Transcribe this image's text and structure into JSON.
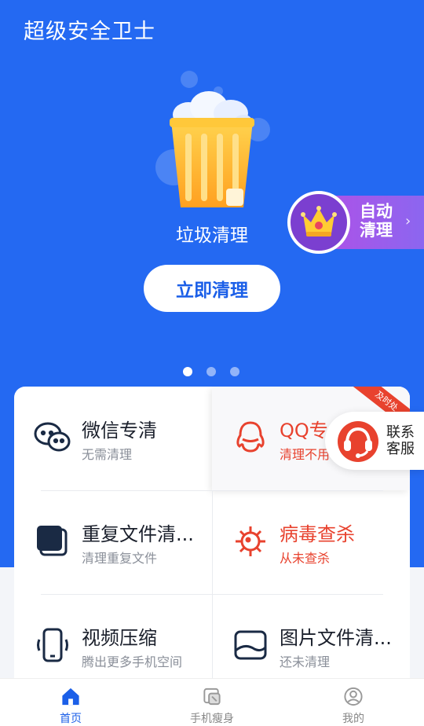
{
  "app": {
    "title": "超级安全卫士"
  },
  "hero": {
    "trash_label": "垃圾清理",
    "clean_button": "立即清理",
    "auto_clean": {
      "line1": "自动",
      "line2": "清理"
    },
    "dots": {
      "count": 3,
      "active_index": 0
    }
  },
  "tiles": [
    {
      "title": "微信专清",
      "sub": "无需清理",
      "icon": "wechat-icon",
      "alert": false
    },
    {
      "title": "QQ专",
      "sub": "清理不用",
      "icon": "qq-icon",
      "alert": true,
      "ribbon": "及时处"
    },
    {
      "title": "重复文件清...",
      "sub": "清理重复文件",
      "icon": "duplicate-files-icon",
      "alert": false
    },
    {
      "title": "病毒查杀",
      "sub": "从未查杀",
      "icon": "virus-icon",
      "alert": true
    },
    {
      "title": "视频压缩",
      "sub": "腾出更多手机空间",
      "icon": "phone-video-icon",
      "alert": false
    },
    {
      "title": "图片文件清...",
      "sub": "还未清理",
      "icon": "image-icon",
      "alert": false
    }
  ],
  "customer_service": {
    "line1": "联系",
    "line2": "客服"
  },
  "tabbar": [
    {
      "label": "首页",
      "icon": "home-icon",
      "active": true
    },
    {
      "label": "手机瘦身",
      "icon": "slim-phone-icon",
      "active": false
    },
    {
      "label": "我的",
      "icon": "profile-icon",
      "active": false
    }
  ],
  "colors": {
    "primary": "#2469f2",
    "alert": "#e8422e",
    "accent_purple": "#b24fe6"
  }
}
